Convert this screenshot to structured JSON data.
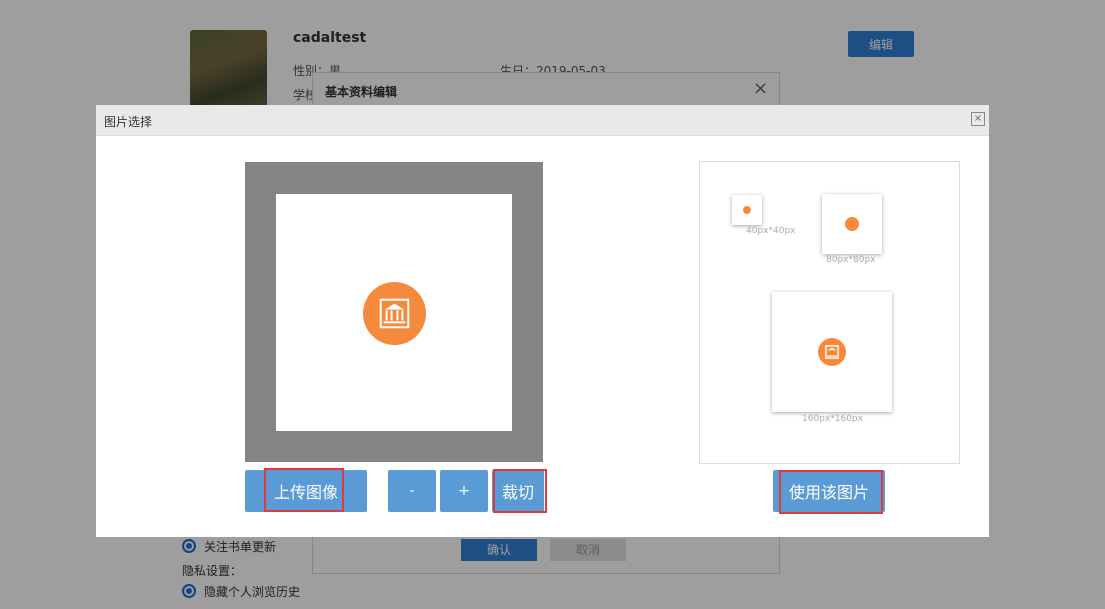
{
  "background_page": {
    "username": "cadaltest",
    "gender": "性别：男",
    "birthday": "生日：2019-05-03",
    "school": "学校",
    "edit_button": "编辑",
    "follow_updates": "关注书单更新",
    "privacy_label": "隐私设置：",
    "hide_history": "隐藏个人浏览历史"
  },
  "basic_dialog": {
    "title": "基本资料编辑",
    "close": "×",
    "confirm": "确认",
    "cancel": "取消"
  },
  "image_dialog": {
    "title": "图片选择",
    "close": "×",
    "upload_button": "上传图像",
    "zoom_out_button": "-",
    "zoom_in_button": "+",
    "crop_button": "裁切",
    "use_button": "使用该图片",
    "preview_labels": {
      "small": "40px*40px",
      "medium": "80px*80px",
      "large": "160px*160px"
    }
  },
  "colors": {
    "accent_blue": "#5b9bd5",
    "logo_orange": "#f58a3c",
    "highlight_red": "#e03a3a"
  },
  "icons": {
    "logo": "library-building-icon",
    "close": "close-icon"
  }
}
